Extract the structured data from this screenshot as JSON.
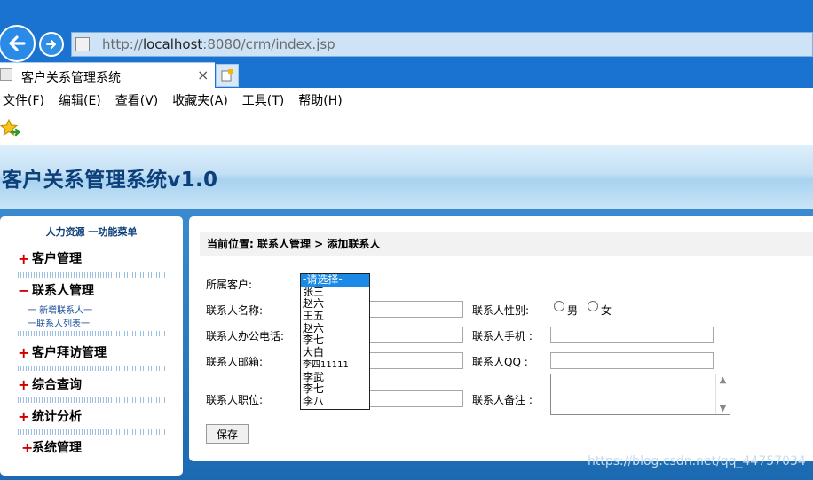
{
  "browser": {
    "url_prefix": "http://",
    "url_host": "localhost",
    "url_rest": ":8080/crm/index.jsp",
    "tab_title": "客户关系管理系统",
    "tab_close": "×",
    "menu": [
      "文件(F)",
      "编辑(E)",
      "查看(V)",
      "收藏夹(A)",
      "工具(T)",
      "帮助(H)"
    ]
  },
  "app": {
    "title": "客户关系管理系统v1.0"
  },
  "sidebar": {
    "heading": "人力资源 一功能菜单",
    "groups": [
      {
        "sign": "+",
        "label": "客户管理"
      },
      {
        "sign": "−",
        "label": "联系人管理"
      },
      {
        "sign": "+",
        "label": "客户拜访管理"
      },
      {
        "sign": "+",
        "label": "综合查询"
      },
      {
        "sign": "+",
        "label": "统计分析"
      },
      {
        "sign": "+",
        "label": "系统管理"
      }
    ],
    "sublinks": [
      "一 新增联系人一",
      "一联系人列表一"
    ]
  },
  "breadcrumb": "当前位置: 联系人管理 > 添加联系人",
  "form": {
    "customer_label": "所属客户:",
    "name_label": "联系人名称:",
    "gender_label": "联系人性别:",
    "gender_male": "男",
    "gender_female": "女",
    "office_phone_label": "联系人办公电话:",
    "mobile_label": "联系人手机 :",
    "email_label": "联系人邮箱:",
    "qq_label": "联系人QQ :",
    "position_label": "联系人职位:",
    "remark_label": "联系人备注 :",
    "save_label": "保存"
  },
  "customer_dropdown": {
    "options": [
      "-请选择-",
      "张三",
      "赵六",
      "王五",
      "赵六",
      "李七",
      "大白",
      "李四11111",
      "李武",
      "李七",
      "李八"
    ],
    "selected_index": 0
  },
  "watermark": "https://blog.csdn.net/qq_44757034"
}
